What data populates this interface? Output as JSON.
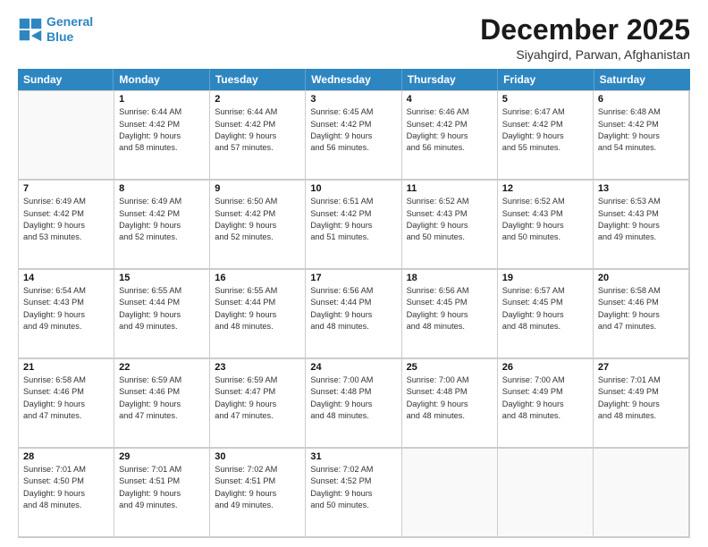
{
  "header": {
    "logo_line1": "General",
    "logo_line2": "Blue",
    "title": "December 2025",
    "subtitle": "Siyahgird, Parwan, Afghanistan"
  },
  "weekdays": [
    "Sunday",
    "Monday",
    "Tuesday",
    "Wednesday",
    "Thursday",
    "Friday",
    "Saturday"
  ],
  "rows": [
    [
      {
        "day": "",
        "lines": []
      },
      {
        "day": "1",
        "lines": [
          "Sunrise: 6:44 AM",
          "Sunset: 4:42 PM",
          "Daylight: 9 hours",
          "and 58 minutes."
        ]
      },
      {
        "day": "2",
        "lines": [
          "Sunrise: 6:44 AM",
          "Sunset: 4:42 PM",
          "Daylight: 9 hours",
          "and 57 minutes."
        ]
      },
      {
        "day": "3",
        "lines": [
          "Sunrise: 6:45 AM",
          "Sunset: 4:42 PM",
          "Daylight: 9 hours",
          "and 56 minutes."
        ]
      },
      {
        "day": "4",
        "lines": [
          "Sunrise: 6:46 AM",
          "Sunset: 4:42 PM",
          "Daylight: 9 hours",
          "and 56 minutes."
        ]
      },
      {
        "day": "5",
        "lines": [
          "Sunrise: 6:47 AM",
          "Sunset: 4:42 PM",
          "Daylight: 9 hours",
          "and 55 minutes."
        ]
      },
      {
        "day": "6",
        "lines": [
          "Sunrise: 6:48 AM",
          "Sunset: 4:42 PM",
          "Daylight: 9 hours",
          "and 54 minutes."
        ]
      }
    ],
    [
      {
        "day": "7",
        "lines": [
          "Sunrise: 6:49 AM",
          "Sunset: 4:42 PM",
          "Daylight: 9 hours",
          "and 53 minutes."
        ]
      },
      {
        "day": "8",
        "lines": [
          "Sunrise: 6:49 AM",
          "Sunset: 4:42 PM",
          "Daylight: 9 hours",
          "and 52 minutes."
        ]
      },
      {
        "day": "9",
        "lines": [
          "Sunrise: 6:50 AM",
          "Sunset: 4:42 PM",
          "Daylight: 9 hours",
          "and 52 minutes."
        ]
      },
      {
        "day": "10",
        "lines": [
          "Sunrise: 6:51 AM",
          "Sunset: 4:42 PM",
          "Daylight: 9 hours",
          "and 51 minutes."
        ]
      },
      {
        "day": "11",
        "lines": [
          "Sunrise: 6:52 AM",
          "Sunset: 4:43 PM",
          "Daylight: 9 hours",
          "and 50 minutes."
        ]
      },
      {
        "day": "12",
        "lines": [
          "Sunrise: 6:52 AM",
          "Sunset: 4:43 PM",
          "Daylight: 9 hours",
          "and 50 minutes."
        ]
      },
      {
        "day": "13",
        "lines": [
          "Sunrise: 6:53 AM",
          "Sunset: 4:43 PM",
          "Daylight: 9 hours",
          "and 49 minutes."
        ]
      }
    ],
    [
      {
        "day": "14",
        "lines": [
          "Sunrise: 6:54 AM",
          "Sunset: 4:43 PM",
          "Daylight: 9 hours",
          "and 49 minutes."
        ]
      },
      {
        "day": "15",
        "lines": [
          "Sunrise: 6:55 AM",
          "Sunset: 4:44 PM",
          "Daylight: 9 hours",
          "and 49 minutes."
        ]
      },
      {
        "day": "16",
        "lines": [
          "Sunrise: 6:55 AM",
          "Sunset: 4:44 PM",
          "Daylight: 9 hours",
          "and 48 minutes."
        ]
      },
      {
        "day": "17",
        "lines": [
          "Sunrise: 6:56 AM",
          "Sunset: 4:44 PM",
          "Daylight: 9 hours",
          "and 48 minutes."
        ]
      },
      {
        "day": "18",
        "lines": [
          "Sunrise: 6:56 AM",
          "Sunset: 4:45 PM",
          "Daylight: 9 hours",
          "and 48 minutes."
        ]
      },
      {
        "day": "19",
        "lines": [
          "Sunrise: 6:57 AM",
          "Sunset: 4:45 PM",
          "Daylight: 9 hours",
          "and 48 minutes."
        ]
      },
      {
        "day": "20",
        "lines": [
          "Sunrise: 6:58 AM",
          "Sunset: 4:46 PM",
          "Daylight: 9 hours",
          "and 47 minutes."
        ]
      }
    ],
    [
      {
        "day": "21",
        "lines": [
          "Sunrise: 6:58 AM",
          "Sunset: 4:46 PM",
          "Daylight: 9 hours",
          "and 47 minutes."
        ]
      },
      {
        "day": "22",
        "lines": [
          "Sunrise: 6:59 AM",
          "Sunset: 4:46 PM",
          "Daylight: 9 hours",
          "and 47 minutes."
        ]
      },
      {
        "day": "23",
        "lines": [
          "Sunrise: 6:59 AM",
          "Sunset: 4:47 PM",
          "Daylight: 9 hours",
          "and 47 minutes."
        ]
      },
      {
        "day": "24",
        "lines": [
          "Sunrise: 7:00 AM",
          "Sunset: 4:48 PM",
          "Daylight: 9 hours",
          "and 48 minutes."
        ]
      },
      {
        "day": "25",
        "lines": [
          "Sunrise: 7:00 AM",
          "Sunset: 4:48 PM",
          "Daylight: 9 hours",
          "and 48 minutes."
        ]
      },
      {
        "day": "26",
        "lines": [
          "Sunrise: 7:00 AM",
          "Sunset: 4:49 PM",
          "Daylight: 9 hours",
          "and 48 minutes."
        ]
      },
      {
        "day": "27",
        "lines": [
          "Sunrise: 7:01 AM",
          "Sunset: 4:49 PM",
          "Daylight: 9 hours",
          "and 48 minutes."
        ]
      }
    ],
    [
      {
        "day": "28",
        "lines": [
          "Sunrise: 7:01 AM",
          "Sunset: 4:50 PM",
          "Daylight: 9 hours",
          "and 48 minutes."
        ]
      },
      {
        "day": "29",
        "lines": [
          "Sunrise: 7:01 AM",
          "Sunset: 4:51 PM",
          "Daylight: 9 hours",
          "and 49 minutes."
        ]
      },
      {
        "day": "30",
        "lines": [
          "Sunrise: 7:02 AM",
          "Sunset: 4:51 PM",
          "Daylight: 9 hours",
          "and 49 minutes."
        ]
      },
      {
        "day": "31",
        "lines": [
          "Sunrise: 7:02 AM",
          "Sunset: 4:52 PM",
          "Daylight: 9 hours",
          "and 50 minutes."
        ]
      },
      {
        "day": "",
        "lines": []
      },
      {
        "day": "",
        "lines": []
      },
      {
        "day": "",
        "lines": []
      }
    ]
  ]
}
